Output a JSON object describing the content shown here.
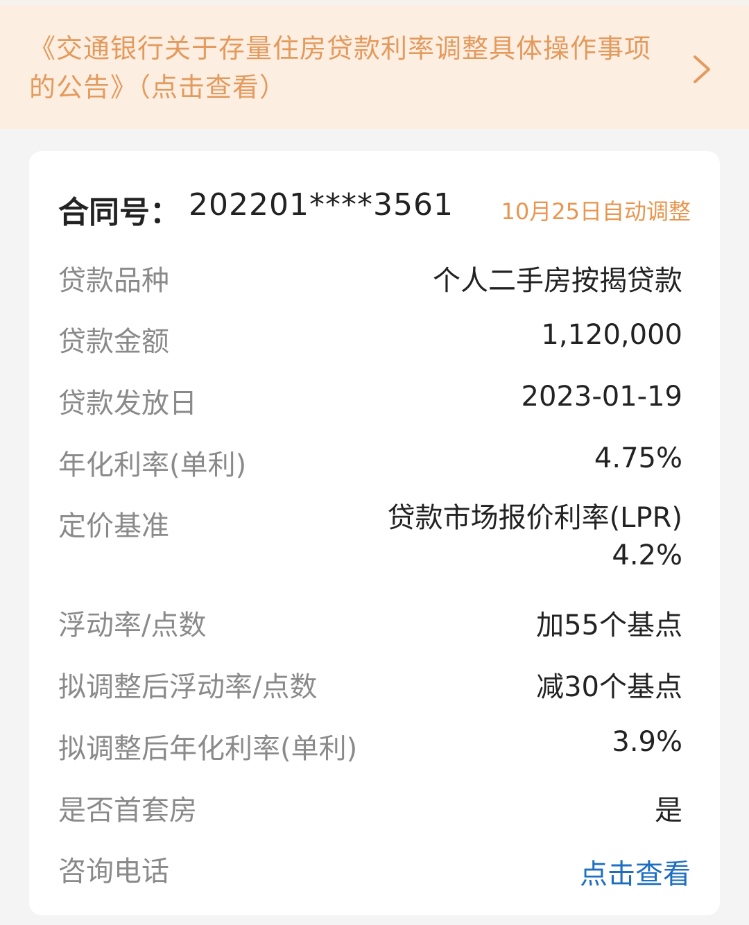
{
  "notice": {
    "line1": "《交通银行关于存量住房贷款利率调整具体操作事项",
    "line2": "的公告》（点击查看）"
  },
  "contract": {
    "label": "合同号：",
    "number": "202201****3561",
    "adjust_badge": "10月25日自动调整"
  },
  "rows": [
    {
      "label": "贷款品种",
      "value": "个人二手房按揭贷款"
    },
    {
      "label": "贷款金额",
      "value": "1,120,000"
    },
    {
      "label": "贷款发放日",
      "value": "2023-01-19"
    },
    {
      "label": "年化利率(单利)",
      "value": "4.75%"
    },
    {
      "label": "定价基准",
      "value": "贷款市场报价利率(LPR)",
      "value2": "4.2%"
    },
    {
      "label": "浮动率/点数",
      "value": "加55个基点"
    },
    {
      "label": "拟调整后浮动率/点数",
      "value": "减30个基点"
    },
    {
      "label": "拟调整后年化利率(单利)",
      "value": "3.9%"
    },
    {
      "label": "是否首套房",
      "value": "是"
    },
    {
      "label": "咨询电话",
      "value": "点击查看"
    }
  ],
  "colors": {
    "notice_bg": "#fdeee2",
    "notice_text": "#e39a5d",
    "badge": "#e8964f",
    "link": "#1e6fc2",
    "label": "#8a8a8a",
    "value": "#222222"
  },
  "icons": {
    "banner_arrow": "chevron-right-icon"
  }
}
